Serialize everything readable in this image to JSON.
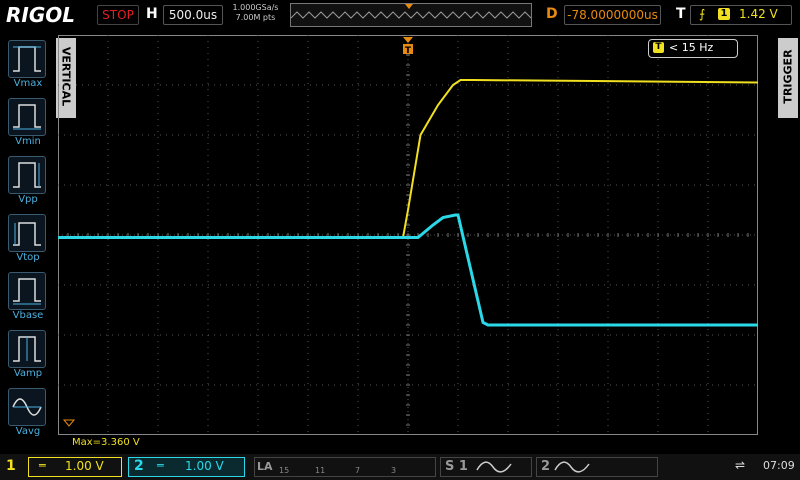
{
  "header": {
    "brand": "RIGOL",
    "run_state": "STOP",
    "h_label": "H",
    "timebase": "500.0us",
    "sample_rate": "1.000GSa/s",
    "mem_depth": "7.00M pts",
    "d_label": "D",
    "delay": "-78.0000000us",
    "t_label": "T",
    "trigger_source": "1",
    "trigger_level": "1.42 V"
  },
  "menus": {
    "vertical_tab": "VERTICAL",
    "trigger_tab": "TRIGGER",
    "measure_items": [
      "Vmax",
      "Vmin",
      "Vpp",
      "Vtop",
      "Vbase",
      "Vamp",
      "Vavg"
    ]
  },
  "screen": {
    "freq_source": "T",
    "freq_readout": "< 15 Hz",
    "measure_result": "Max=3.360 V",
    "trigger_marker": "T"
  },
  "channels": {
    "ch1": {
      "number": "1",
      "symbol": "═",
      "scale": "1.00 V",
      "color": "#f0e020"
    },
    "ch2": {
      "number": "2",
      "symbol": "═",
      "scale": "1.00 V",
      "color": "#2ad8e8"
    },
    "la": {
      "label": "LA",
      "groups": [
        "15",
        "11",
        "7",
        "3"
      ]
    },
    "s1": "S 1",
    "s2": "2"
  },
  "status": {
    "time": "07:09"
  },
  "chart_data": {
    "type": "line",
    "x_divisions": 14,
    "y_divisions": 8,
    "series": [
      {
        "color": "#f0e020",
        "points": [
          [
            0,
            3.95
          ],
          [
            6.9,
            3.95
          ],
          [
            7.0,
            4.5
          ],
          [
            7.25,
            6.0
          ],
          [
            7.6,
            6.6
          ],
          [
            7.9,
            7.0
          ],
          [
            8.05,
            7.1
          ],
          [
            8.3,
            7.1
          ],
          [
            14,
            7.05
          ]
        ]
      },
      {
        "color": "#2ad8e8",
        "points": [
          [
            0,
            3.95
          ],
          [
            7.2,
            3.95
          ],
          [
            7.5,
            4.2
          ],
          [
            7.7,
            4.35
          ],
          [
            7.95,
            4.4
          ],
          [
            8.0,
            4.4
          ],
          [
            8.5,
            2.25
          ],
          [
            8.6,
            2.2
          ],
          [
            14,
            2.2
          ]
        ]
      }
    ],
    "grid": true
  }
}
